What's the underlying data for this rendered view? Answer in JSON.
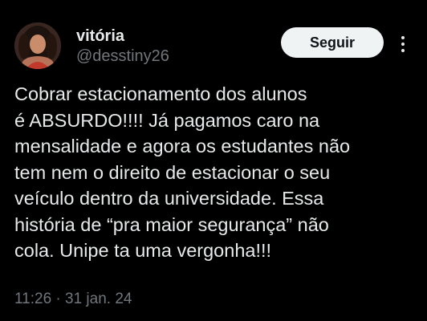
{
  "author": {
    "display_name": "vitória",
    "handle": "@desstiny26",
    "avatar_icon": "profile-photo"
  },
  "follow_button": {
    "label": "Seguir"
  },
  "more_menu": {
    "icon": "more-vertical-icon"
  },
  "tweet": {
    "lines": [
      "Cobrar estacionamento dos alunos",
      "é ABSURDO!!!! Já pagamos caro na",
      "mensalidade e agora os estudantes não",
      "tem nem o direito de estacionar o seu",
      "veículo dentro da universidade. Essa",
      "história de “pra maior segurança” não",
      "cola. Unipe ta uma vergonha!!!"
    ],
    "timestamp": "11:26 · 31 jan. 24"
  },
  "colors": {
    "background": "#000000",
    "primary_text": "#e7e9ea",
    "secondary_text": "#71767b",
    "button_bg": "#eff3f4",
    "button_text": "#0f1419"
  }
}
